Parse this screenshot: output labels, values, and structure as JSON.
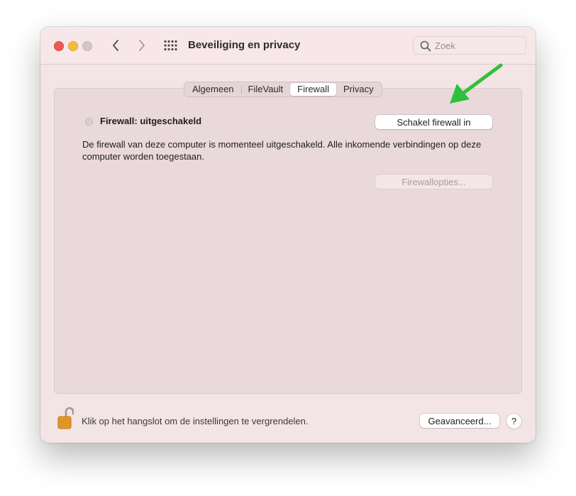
{
  "window": {
    "title": "Beveiliging en privacy",
    "search": {
      "placeholder": "Zoek",
      "value": ""
    }
  },
  "tabs": [
    {
      "label": "Algemeen",
      "active": false
    },
    {
      "label": "FileVault",
      "active": false
    },
    {
      "label": "Firewall",
      "active": true
    },
    {
      "label": "Privacy",
      "active": false
    }
  ],
  "firewall": {
    "status_label": "Firewall: uitgeschakeld",
    "enable_button": "Schakel firewall in",
    "description": "De firewall van deze computer is momenteel uitgeschakeld. Alle inkomende verbindingen op deze computer worden toegestaan.",
    "options_button": "Firewallopties..."
  },
  "footer": {
    "lock_text": "Klik op het hangslot om de instellingen te vergrendelen.",
    "advanced_button": "Geavanceerd...",
    "help_label": "?"
  },
  "colors": {
    "window_bg": "#f3e4e5",
    "panel_bg": "#ead9da",
    "annotation_arrow": "#2fc13c",
    "close": "#ee5b54",
    "minimize": "#f6bb3c"
  }
}
